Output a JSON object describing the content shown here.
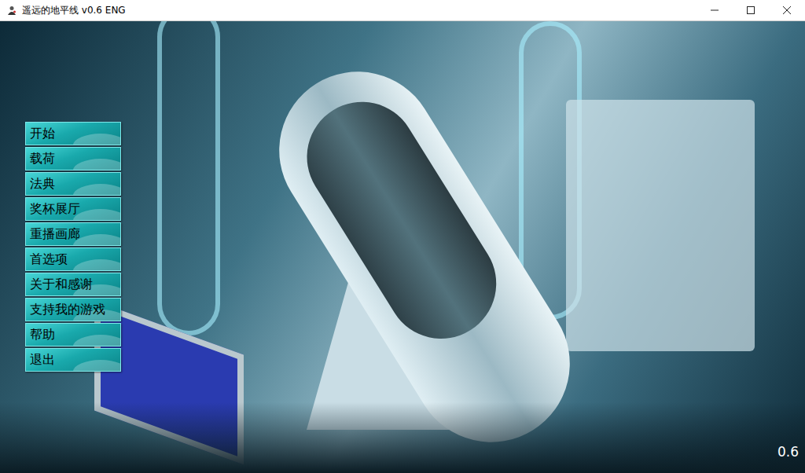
{
  "window": {
    "title": "遥远的地平线 v0.6 ENG"
  },
  "menu": {
    "items": [
      {
        "label": "开始"
      },
      {
        "label": "载荷"
      },
      {
        "label": "法典"
      },
      {
        "label": "奖杯展厅"
      },
      {
        "label": "重播画廊"
      },
      {
        "label": "首选项"
      },
      {
        "label": "关于和感谢"
      },
      {
        "label": "支持我的游戏"
      },
      {
        "label": "帮助"
      },
      {
        "label": "退出"
      }
    ]
  },
  "version": "0.6"
}
